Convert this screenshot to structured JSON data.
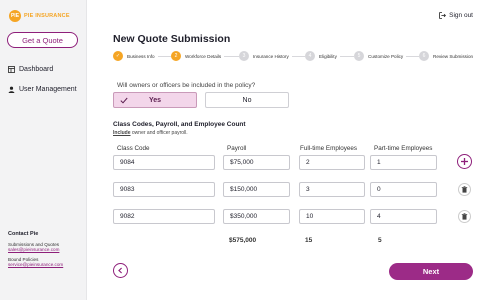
{
  "brand": {
    "logo_mark": "PIE",
    "logo_text": "PIE INSURANCE",
    "accent": "#8e1f7a",
    "logo_color": "#f5a524"
  },
  "sidebar": {
    "cta_label": "Get a Quote",
    "nav": [
      {
        "label": "Dashboard",
        "icon": "dashboard-icon"
      },
      {
        "label": "User Management",
        "icon": "user-icon"
      }
    ],
    "contact": {
      "title": "Contact Pie",
      "quotes_label": "Submissions and Quotes",
      "quotes_email": "sales@pieinsurance.com",
      "bound_label": "Bound Policies",
      "bound_email": "service@pieinsurance.com"
    }
  },
  "header": {
    "signout_label": "Sign out",
    "title": "New Quote Submission"
  },
  "stepper": {
    "steps": [
      {
        "label": "Business Info",
        "status": "done",
        "num": ""
      },
      {
        "label": "Workforce Details",
        "status": "current",
        "num": "2"
      },
      {
        "label": "Insurance History",
        "status": "todo",
        "num": "3"
      },
      {
        "label": "Eligibility",
        "status": "todo",
        "num": "4"
      },
      {
        "label": "Customize Policy",
        "status": "todo",
        "num": "5"
      },
      {
        "label": "Review Submission",
        "status": "todo",
        "num": "6"
      }
    ]
  },
  "question": {
    "text": "Will owners or officers be included in the policy?",
    "yes": "Yes",
    "no": "No",
    "selected": "Yes"
  },
  "section": {
    "title": "Class Codes, Payroll, and Employee Count",
    "sub_bold": "Include",
    "sub_rest": " owner and officer payroll."
  },
  "table": {
    "headers": [
      "Class Code",
      "Payroll",
      "Full-time Employees",
      "Part-time Employees"
    ],
    "rows": [
      {
        "code": "9084",
        "payroll": "$75,000",
        "full": "2",
        "part": "1"
      },
      {
        "code": "9083",
        "payroll": "$150,000",
        "full": "3",
        "part": "0"
      },
      {
        "code": "9082",
        "payroll": "$350,000",
        "full": "10",
        "part": "4"
      }
    ],
    "totals": {
      "payroll": "$575,000",
      "full": "15",
      "part": "5"
    }
  },
  "footer": {
    "next_label": "Next"
  }
}
